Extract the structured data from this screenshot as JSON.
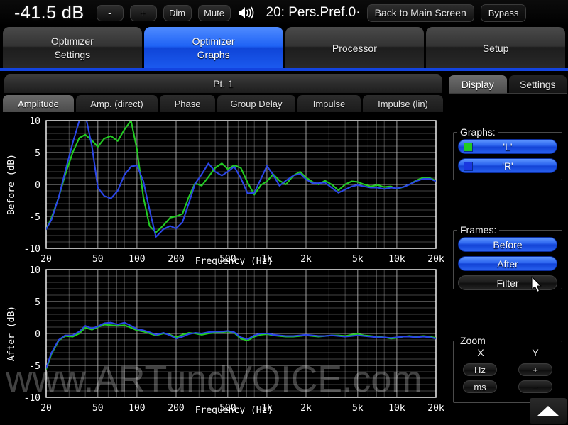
{
  "topbar": {
    "volume": "-41.5 dB",
    "minus_label": "-",
    "plus_label": "+",
    "dim_label": "Dim",
    "mute_label": "Mute",
    "speaker_icon": "speaker-icon",
    "preset": "20: Pers.Pref.0·",
    "back_label": "Back to Main Screen",
    "bypass_label": "Bypass"
  },
  "main_tabs": [
    {
      "line1": "Optimizer",
      "line2": "Settings",
      "active": false
    },
    {
      "line1": "Optimizer",
      "line2": "Graphs",
      "active": true
    },
    {
      "line1": "Processor",
      "line2": "",
      "active": false
    },
    {
      "line1": "Setup",
      "line2": "",
      "active": false
    }
  ],
  "point_bar": {
    "label": "Pt. 1"
  },
  "graph_tabs": [
    {
      "label": "Amplitude",
      "active": true
    },
    {
      "label": "Amp. (direct)",
      "active": false
    },
    {
      "label": "Phase",
      "active": false
    },
    {
      "label": "Group Delay",
      "active": false
    },
    {
      "label": "Impulse",
      "active": false
    },
    {
      "label": "Impulse (lin)",
      "active": false
    }
  ],
  "side_panel": {
    "tabs": [
      {
        "label": "Display",
        "active": true
      },
      {
        "label": "Settings",
        "active": false
      }
    ],
    "graphs_group": {
      "title": "Graphs:",
      "items": [
        {
          "label": "'L'",
          "color": "#22cc22",
          "active": true
        },
        {
          "label": "'R'",
          "color": "#1a38e0",
          "active": true
        }
      ]
    },
    "frames_group": {
      "title": "Frames:",
      "items": [
        {
          "label": "Before",
          "active": true
        },
        {
          "label": "After",
          "active": true
        },
        {
          "label": "Filter",
          "active": false
        }
      ]
    },
    "zoom_group": {
      "title": "Zoom",
      "x_label": "X",
      "y_label": "Y",
      "x_buttons": [
        "Hz",
        "ms"
      ],
      "y_buttons": [
        "+",
        "−"
      ]
    },
    "scroll_up_icon": "triangle-up-icon"
  },
  "watermark": "www.ARTundVOICE.com",
  "colors": {
    "accent_blue": "#1243d6",
    "trace_left": "#22cc22",
    "trace_right": "#2b46e8",
    "grid": "#b9b9b9",
    "plot_bg": "#000000"
  },
  "chart_data": [
    {
      "type": "line",
      "id": "before",
      "title": "",
      "xlabel": "Frequency (Hz)",
      "ylabel": "Before (dB)",
      "xscale": "log",
      "xlim": [
        20,
        20000
      ],
      "ylim": [
        -10,
        10
      ],
      "xticks": [
        20,
        50,
        100,
        200,
        500,
        1000,
        2000,
        5000,
        10000,
        20000
      ],
      "xticklabels": [
        "20",
        "50",
        "100",
        "200",
        "500",
        "1k",
        "2k",
        "5k",
        "10k",
        "20k"
      ],
      "yticks": [
        -10,
        -5,
        0,
        5,
        10
      ],
      "yticklabels": [
        "-10",
        "-5",
        "0",
        "5",
        "10"
      ],
      "grid": true,
      "legend": false,
      "series": [
        {
          "name": "'L'",
          "color": "#22cc22",
          "x": [
            20,
            22,
            25,
            28,
            32,
            36,
            40,
            45,
            50,
            56,
            63,
            71,
            80,
            90,
            100,
            112,
            125,
            140,
            160,
            180,
            200,
            224,
            250,
            280,
            315,
            355,
            400,
            450,
            500,
            560,
            630,
            710,
            800,
            900,
            1000,
            1120,
            1250,
            1400,
            1600,
            1800,
            2000,
            2240,
            2500,
            2800,
            3150,
            3550,
            4000,
            4500,
            5000,
            5600,
            6300,
            7100,
            8000,
            9000,
            10000,
            11200,
            12500,
            14000,
            16000,
            18000,
            20000
          ],
          "y": [
            -7.0,
            -5.2,
            -2.0,
            1.5,
            5.0,
            7.3,
            7.8,
            6.9,
            5.9,
            7.2,
            7.6,
            6.8,
            8.6,
            10.0,
            5.5,
            -2.0,
            -6.5,
            -7.5,
            -6.4,
            -5.2,
            -5.0,
            -4.6,
            -2.0,
            0.2,
            -0.2,
            1.2,
            2.6,
            3.3,
            2.4,
            3.0,
            2.6,
            0.3,
            -1.6,
            -0.1,
            0.5,
            1.6,
            0.6,
            0.0,
            1.4,
            2.0,
            1.1,
            0.4,
            0.0,
            0.6,
            0.0,
            -0.9,
            0.0,
            0.5,
            0.4,
            0.0,
            -0.3,
            -0.1,
            -0.4,
            -0.3,
            -0.7,
            -0.4,
            0.0,
            0.6,
            1.1,
            1.0,
            0.6
          ]
        },
        {
          "name": "'R'",
          "color": "#2b46e8",
          "x": [
            20,
            22,
            25,
            28,
            32,
            36,
            40,
            45,
            50,
            56,
            63,
            71,
            80,
            90,
            100,
            112,
            125,
            140,
            160,
            180,
            200,
            224,
            250,
            280,
            315,
            355,
            400,
            450,
            500,
            560,
            630,
            710,
            800,
            900,
            1000,
            1120,
            1250,
            1400,
            1600,
            1800,
            2000,
            2240,
            2500,
            2800,
            3150,
            3550,
            4000,
            4500,
            5000,
            5600,
            6300,
            7100,
            8000,
            9000,
            10000,
            11200,
            12500,
            14000,
            16000,
            18000,
            20000
          ],
          "y": [
            -7.0,
            -5.5,
            -2.0,
            2.0,
            6.5,
            10.0,
            11.0,
            6.0,
            -0.5,
            -1.8,
            -2.2,
            -1.0,
            1.5,
            2.8,
            3.0,
            0.5,
            -4.0,
            -8.2,
            -7.0,
            -6.5,
            -6.9,
            -5.9,
            -3.0,
            0.1,
            1.6,
            3.3,
            2.0,
            1.4,
            2.0,
            2.8,
            1.0,
            -1.4,
            -1.3,
            0.9,
            2.9,
            1.5,
            -0.2,
            0.6,
            1.4,
            1.7,
            0.8,
            0.2,
            0.2,
            0.3,
            -0.5,
            -1.3,
            -0.8,
            -0.3,
            -0.1,
            -0.3,
            -0.5,
            -0.5,
            -0.7,
            -0.5,
            -0.6,
            -0.4,
            0.0,
            0.5,
            0.9,
            0.9,
            0.5
          ]
        }
      ]
    },
    {
      "type": "line",
      "id": "after",
      "title": "",
      "xlabel": "Frequency (Hz)",
      "ylabel": "After (dB)",
      "xscale": "log",
      "xlim": [
        20,
        20000
      ],
      "ylim": [
        -10,
        10
      ],
      "xticks": [
        20,
        50,
        100,
        200,
        500,
        1000,
        2000,
        5000,
        10000,
        20000
      ],
      "xticklabels": [
        "20",
        "50",
        "100",
        "200",
        "500",
        "1k",
        "2k",
        "5k",
        "10k",
        "20k"
      ],
      "yticks": [
        -10,
        -5,
        0,
        5,
        10
      ],
      "yticklabels": [
        "-10",
        "-5",
        "0",
        "5",
        "10"
      ],
      "grid": true,
      "legend": false,
      "series": [
        {
          "name": "'L'",
          "color": "#22cc22",
          "x": [
            20,
            22,
            25,
            28,
            32,
            36,
            40,
            45,
            50,
            56,
            63,
            71,
            80,
            90,
            100,
            112,
            125,
            140,
            160,
            180,
            200,
            224,
            250,
            280,
            315,
            355,
            400,
            450,
            500,
            560,
            630,
            710,
            800,
            900,
            1000,
            1120,
            1250,
            1400,
            1600,
            1800,
            2000,
            2240,
            2500,
            2800,
            3150,
            3550,
            4000,
            4500,
            5000,
            5600,
            6300,
            7100,
            8000,
            9000,
            10000,
            11200,
            12500,
            14000,
            16000,
            18000,
            20000
          ],
          "y": [
            -5.6,
            -3.2,
            -1.1,
            -0.4,
            -0.5,
            0.0,
            0.9,
            0.6,
            1.0,
            1.4,
            1.3,
            1.2,
            1.3,
            0.9,
            0.5,
            0.3,
            0.0,
            -0.3,
            0.0,
            -0.2,
            -0.6,
            -0.2,
            0.1,
            0.0,
            -0.2,
            0.0,
            0.1,
            0.2,
            0.3,
            0.1,
            -0.8,
            -1.1,
            -0.5,
            -0.2,
            -0.1,
            -0.3,
            -0.4,
            -0.5,
            -0.5,
            -0.4,
            -0.3,
            -0.4,
            -0.5,
            -0.4,
            -0.3,
            -0.3,
            -0.4,
            -0.2,
            -0.1,
            -0.3,
            -0.4,
            -0.5,
            -0.6,
            -0.8,
            -0.7,
            -0.5,
            -0.4,
            -0.5,
            -0.4,
            -0.5,
            -0.7
          ]
        },
        {
          "name": "'R'",
          "color": "#2b46e8",
          "x": [
            20,
            22,
            25,
            28,
            32,
            36,
            40,
            45,
            50,
            56,
            63,
            71,
            80,
            90,
            100,
            112,
            125,
            140,
            160,
            180,
            200,
            224,
            250,
            280,
            315,
            355,
            400,
            450,
            500,
            560,
            630,
            710,
            800,
            900,
            1000,
            1120,
            1250,
            1400,
            1600,
            1800,
            2000,
            2240,
            2500,
            2800,
            3150,
            3550,
            4000,
            4500,
            5000,
            5600,
            6300,
            7100,
            8000,
            9000,
            10000,
            11200,
            12500,
            14000,
            16000,
            18000,
            20000
          ],
          "y": [
            -5.4,
            -3.0,
            -1.0,
            -0.3,
            -0.3,
            0.3,
            1.2,
            0.8,
            1.1,
            1.6,
            1.7,
            1.4,
            1.7,
            1.2,
            0.7,
            0.5,
            0.2,
            -0.2,
            0.1,
            -0.3,
            -0.8,
            -0.5,
            -0.1,
            0.1,
            0.0,
            0.2,
            0.3,
            0.3,
            0.4,
            0.2,
            -0.6,
            -0.9,
            -0.3,
            0.0,
            0.0,
            -0.2,
            -0.3,
            -0.4,
            -0.4,
            -0.3,
            -0.2,
            -0.3,
            -0.4,
            -0.4,
            -0.3,
            -0.4,
            -0.5,
            -0.4,
            -0.3,
            -0.4,
            -0.5,
            -0.6,
            -0.6,
            -0.7,
            -0.6,
            -0.5,
            -0.5,
            -0.6,
            -0.5,
            -0.6,
            -0.8
          ]
        }
      ]
    }
  ]
}
